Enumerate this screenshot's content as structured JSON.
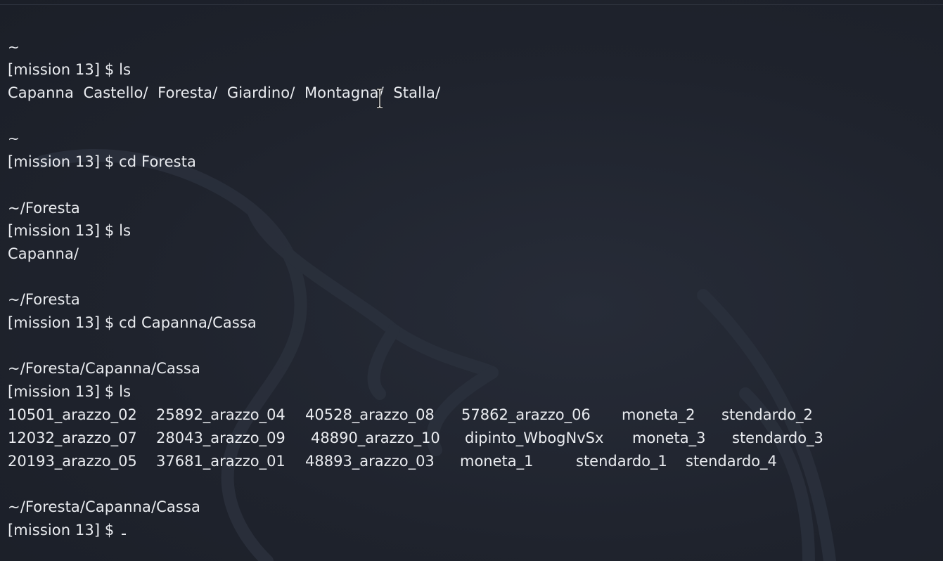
{
  "terminal": {
    "blocks": [
      {
        "path": "~",
        "prompt": "[mission 13] $ ls",
        "output": [
          "Capanna  Castello/  Foresta/  Giardino/  Montagna/  Stalla/"
        ]
      },
      {
        "path": "~",
        "prompt": "[mission 13] $ cd Foresta",
        "output": []
      },
      {
        "path": "~/Foresta",
        "prompt": "[mission 13] $ ls",
        "output": [
          "Capanna/"
        ]
      },
      {
        "path": "~/Foresta",
        "prompt": "[mission 13] $ cd Capanna/Cassa",
        "output": []
      },
      {
        "path": "~/Foresta/Capanna/Cassa",
        "prompt": "[mission 13] $ ls",
        "output": []
      },
      {
        "path": "~/Foresta/Capanna/Cassa",
        "prompt": "[mission 13] $ ",
        "output": []
      }
    ],
    "ls_grid": [
      [
        "10501_arazzo_02",
        "25892_arazzo_04",
        "40528_arazzo_08",
        "57862_arazzo_06",
        "moneta_2",
        "stendardo_2"
      ],
      [
        "12032_arazzo_07",
        "28043_arazzo_09",
        "48890_arazzo_10",
        "dipinto_WbogNvSx",
        "moneta_3",
        "stendardo_3"
      ],
      [
        "20193_arazzo_05",
        "37681_arazzo_01",
        "48893_arazzo_03",
        "moneta_1",
        "stendardo_1",
        "stendardo_4"
      ]
    ]
  },
  "colors": {
    "background": "#1e222c",
    "text": "#e9ebef"
  },
  "icons": {
    "cursor": "text-ibeam-cursor",
    "watermark": "kali-dragon-watermark"
  }
}
